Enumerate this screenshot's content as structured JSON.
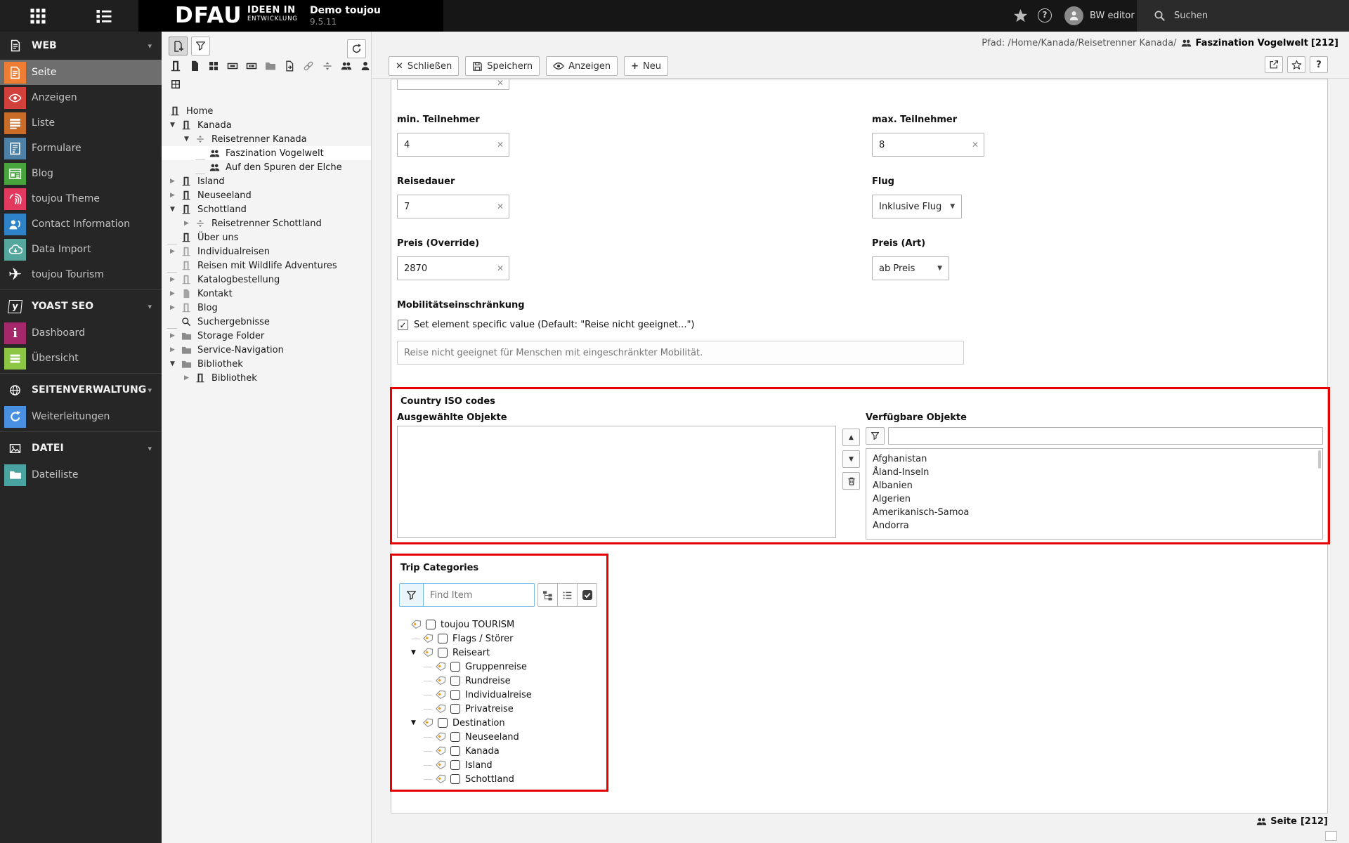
{
  "topbar": {
    "brand": "DFAU",
    "brand_tagline_1": "IDEEN IN",
    "brand_tagline_2": "ENTWICKLUNG",
    "site_title": "Demo toujou",
    "version": "9.5.11",
    "user_name": "BW editor",
    "search_placeholder": "Suchen"
  },
  "sidebar": {
    "sections": [
      {
        "header": "WEB",
        "items": [
          {
            "label": "Seite",
            "color": "#ef7d33"
          },
          {
            "label": "Anzeigen",
            "color": "#d2403c"
          },
          {
            "label": "Liste",
            "color": "#c96c27"
          },
          {
            "label": "Formulare",
            "color": "#4c80a6"
          },
          {
            "label": "Blog",
            "color": "#48a53d"
          },
          {
            "label": "toujou Theme",
            "color": "#e23a5f"
          },
          {
            "label": "Contact Information",
            "color": "#2e82c8"
          },
          {
            "label": "Data Import",
            "color": "#55a79e"
          },
          {
            "label": "toujou Tourism",
            "color": "transparent"
          }
        ]
      },
      {
        "header": "YOAST SEO",
        "items": [
          {
            "label": "Dashboard",
            "color": "#a4286a"
          },
          {
            "label": "Übersicht",
            "color": "#8dc643"
          }
        ]
      },
      {
        "header": "SEITENVERWALTUNG",
        "items": [
          {
            "label": "Weiterleitungen",
            "color": "#4a90e2"
          }
        ]
      },
      {
        "header": "DATEI",
        "items": [
          {
            "label": "Dateiliste",
            "color": "#49a3a0"
          }
        ]
      }
    ]
  },
  "pagetree": {
    "drag_icons": [
      "page",
      "file",
      "grid",
      "backend-section",
      "mount-point",
      "folder",
      "shortcut",
      "link",
      "spacer",
      "user-section",
      "user"
    ],
    "extra_icon": "content-grid",
    "nodes": [
      {
        "label": "Home"
      },
      {
        "label": "Kanada"
      },
      {
        "label": "Reisetrenner Kanada"
      },
      {
        "label": "Faszination Vogelwelt"
      },
      {
        "label": "Auf den Spuren der Elche"
      },
      {
        "label": "Island"
      },
      {
        "label": "Neuseeland"
      },
      {
        "label": "Schottland"
      },
      {
        "label": "Reisetrenner Schottland"
      },
      {
        "label": "Über uns"
      },
      {
        "label": "Individualreisen"
      },
      {
        "label": "Reisen mit Wildlife Adventures"
      },
      {
        "label": "Katalogbestellung"
      },
      {
        "label": "Kontakt"
      },
      {
        "label": "Blog"
      },
      {
        "label": "Suchergebnisse"
      },
      {
        "label": "Storage Folder"
      },
      {
        "label": "Service-Navigation"
      },
      {
        "label": "Bibliothek"
      },
      {
        "label": "Bibliothek"
      }
    ]
  },
  "docheader": {
    "path_label": "Pfad:",
    "path": "/Home/Kanada/Reisetrenner Kanada/",
    "record_title": "Faszination Vogelwelt",
    "record_id": "[212]",
    "buttons": {
      "close": "Schließen",
      "save": "Speichern",
      "view": "Anzeigen",
      "new": "Neu"
    }
  },
  "form": {
    "min_participants": {
      "label": "min. Teilnehmer",
      "value": "4"
    },
    "max_participants": {
      "label": "max. Teilnehmer",
      "value": "8"
    },
    "duration": {
      "label": "Reisedauer",
      "value": "7"
    },
    "flight": {
      "label": "Flug",
      "value": "Inklusive Flug"
    },
    "price_override": {
      "label": "Preis (Override)",
      "value": "2870"
    },
    "price_type": {
      "label": "Preis (Art)",
      "value": "ab Preis"
    },
    "mobility": {
      "label": "Mobilitätseinschränkung",
      "checkbox_label": "Set element specific value (Default: \"Reise nicht geeignet...\")",
      "placeholder": "Reise nicht geeignet für Menschen mit eingeschränkter Mobilität."
    }
  },
  "country_codes": {
    "title": "Country ISO codes",
    "selected_label": "Ausgewählte Objekte",
    "available_label": "Verfügbare Objekte",
    "options": [
      "Afghanistan",
      "Åland-Inseln",
      "Albanien",
      "Algerien",
      "Amerikanisch-Samoa",
      "Andorra"
    ]
  },
  "trip_categories": {
    "title": "Trip Categories",
    "filter_placeholder": "Find Item",
    "toolbar_icons": [
      "expand-tree",
      "list-view",
      "select-all"
    ],
    "nodes": [
      {
        "label": "toujou TOURISM",
        "depth": 0
      },
      {
        "label": "Flags / Störer",
        "depth": 1
      },
      {
        "label": "Reiseart",
        "depth": 1,
        "expanded": true
      },
      {
        "label": "Gruppenreise",
        "depth": 2
      },
      {
        "label": "Rundreise",
        "depth": 2
      },
      {
        "label": "Individualreise",
        "depth": 2
      },
      {
        "label": "Privatreise",
        "depth": 2
      },
      {
        "label": "Destination",
        "depth": 1,
        "expanded": true
      },
      {
        "label": "Neuseeland",
        "depth": 2
      },
      {
        "label": "Kanada",
        "depth": 2
      },
      {
        "label": "Island",
        "depth": 2
      },
      {
        "label": "Schottland",
        "depth": 2
      }
    ]
  },
  "footer": {
    "record_type": "Seite",
    "record_id": "[212]"
  }
}
